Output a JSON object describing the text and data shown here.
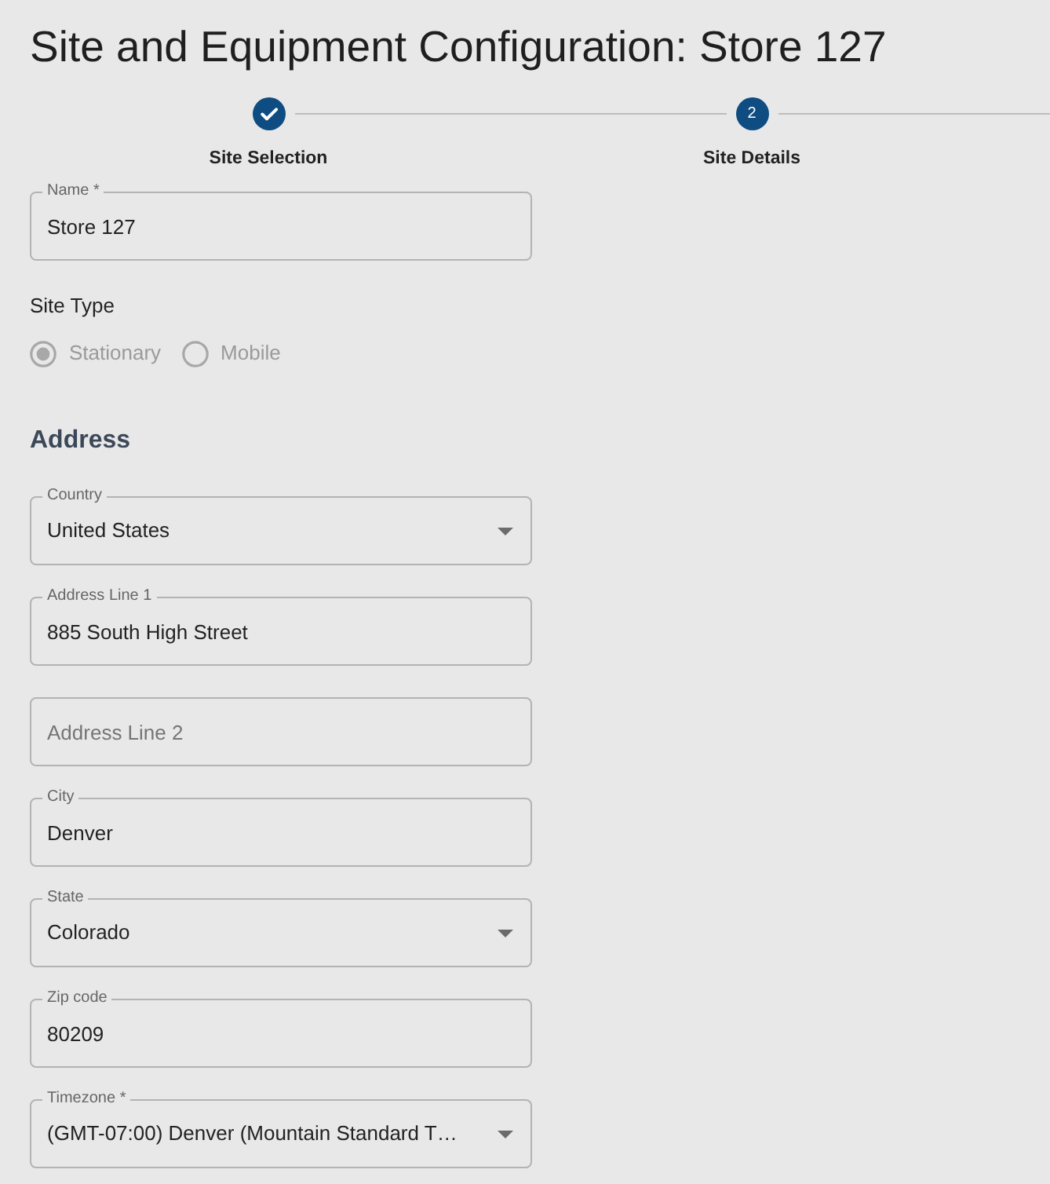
{
  "title": "Site and Equipment Configuration: Store 127",
  "stepper": {
    "steps": [
      {
        "kind": "completed",
        "label": "Site Selection"
      },
      {
        "kind": "current",
        "number": "2",
        "label": "Site Details"
      }
    ]
  },
  "name_field": {
    "kind": "text",
    "label": "Name *",
    "value": "Store 127"
  },
  "site_type": {
    "label": "Site Type",
    "disabled": true,
    "options": [
      {
        "label": "Stationary",
        "selected": true
      },
      {
        "label": "Mobile",
        "selected": false
      }
    ]
  },
  "address": {
    "heading": "Address",
    "fields": [
      {
        "kind": "select",
        "label": "Country",
        "value": "United States"
      },
      {
        "kind": "text",
        "label": "Address Line 1",
        "value": "885 South High Street"
      },
      {
        "kind": "text",
        "placeholder": "Address Line 2"
      },
      {
        "kind": "text",
        "label": "City",
        "value": "Denver"
      },
      {
        "kind": "select",
        "label": "State",
        "value": "Colorado"
      },
      {
        "kind": "text",
        "label": "Zip code",
        "value": "80209"
      },
      {
        "kind": "select",
        "label": "Timezone *",
        "value": "(GMT-07:00) Denver (Mountain Standard T…"
      }
    ]
  }
}
